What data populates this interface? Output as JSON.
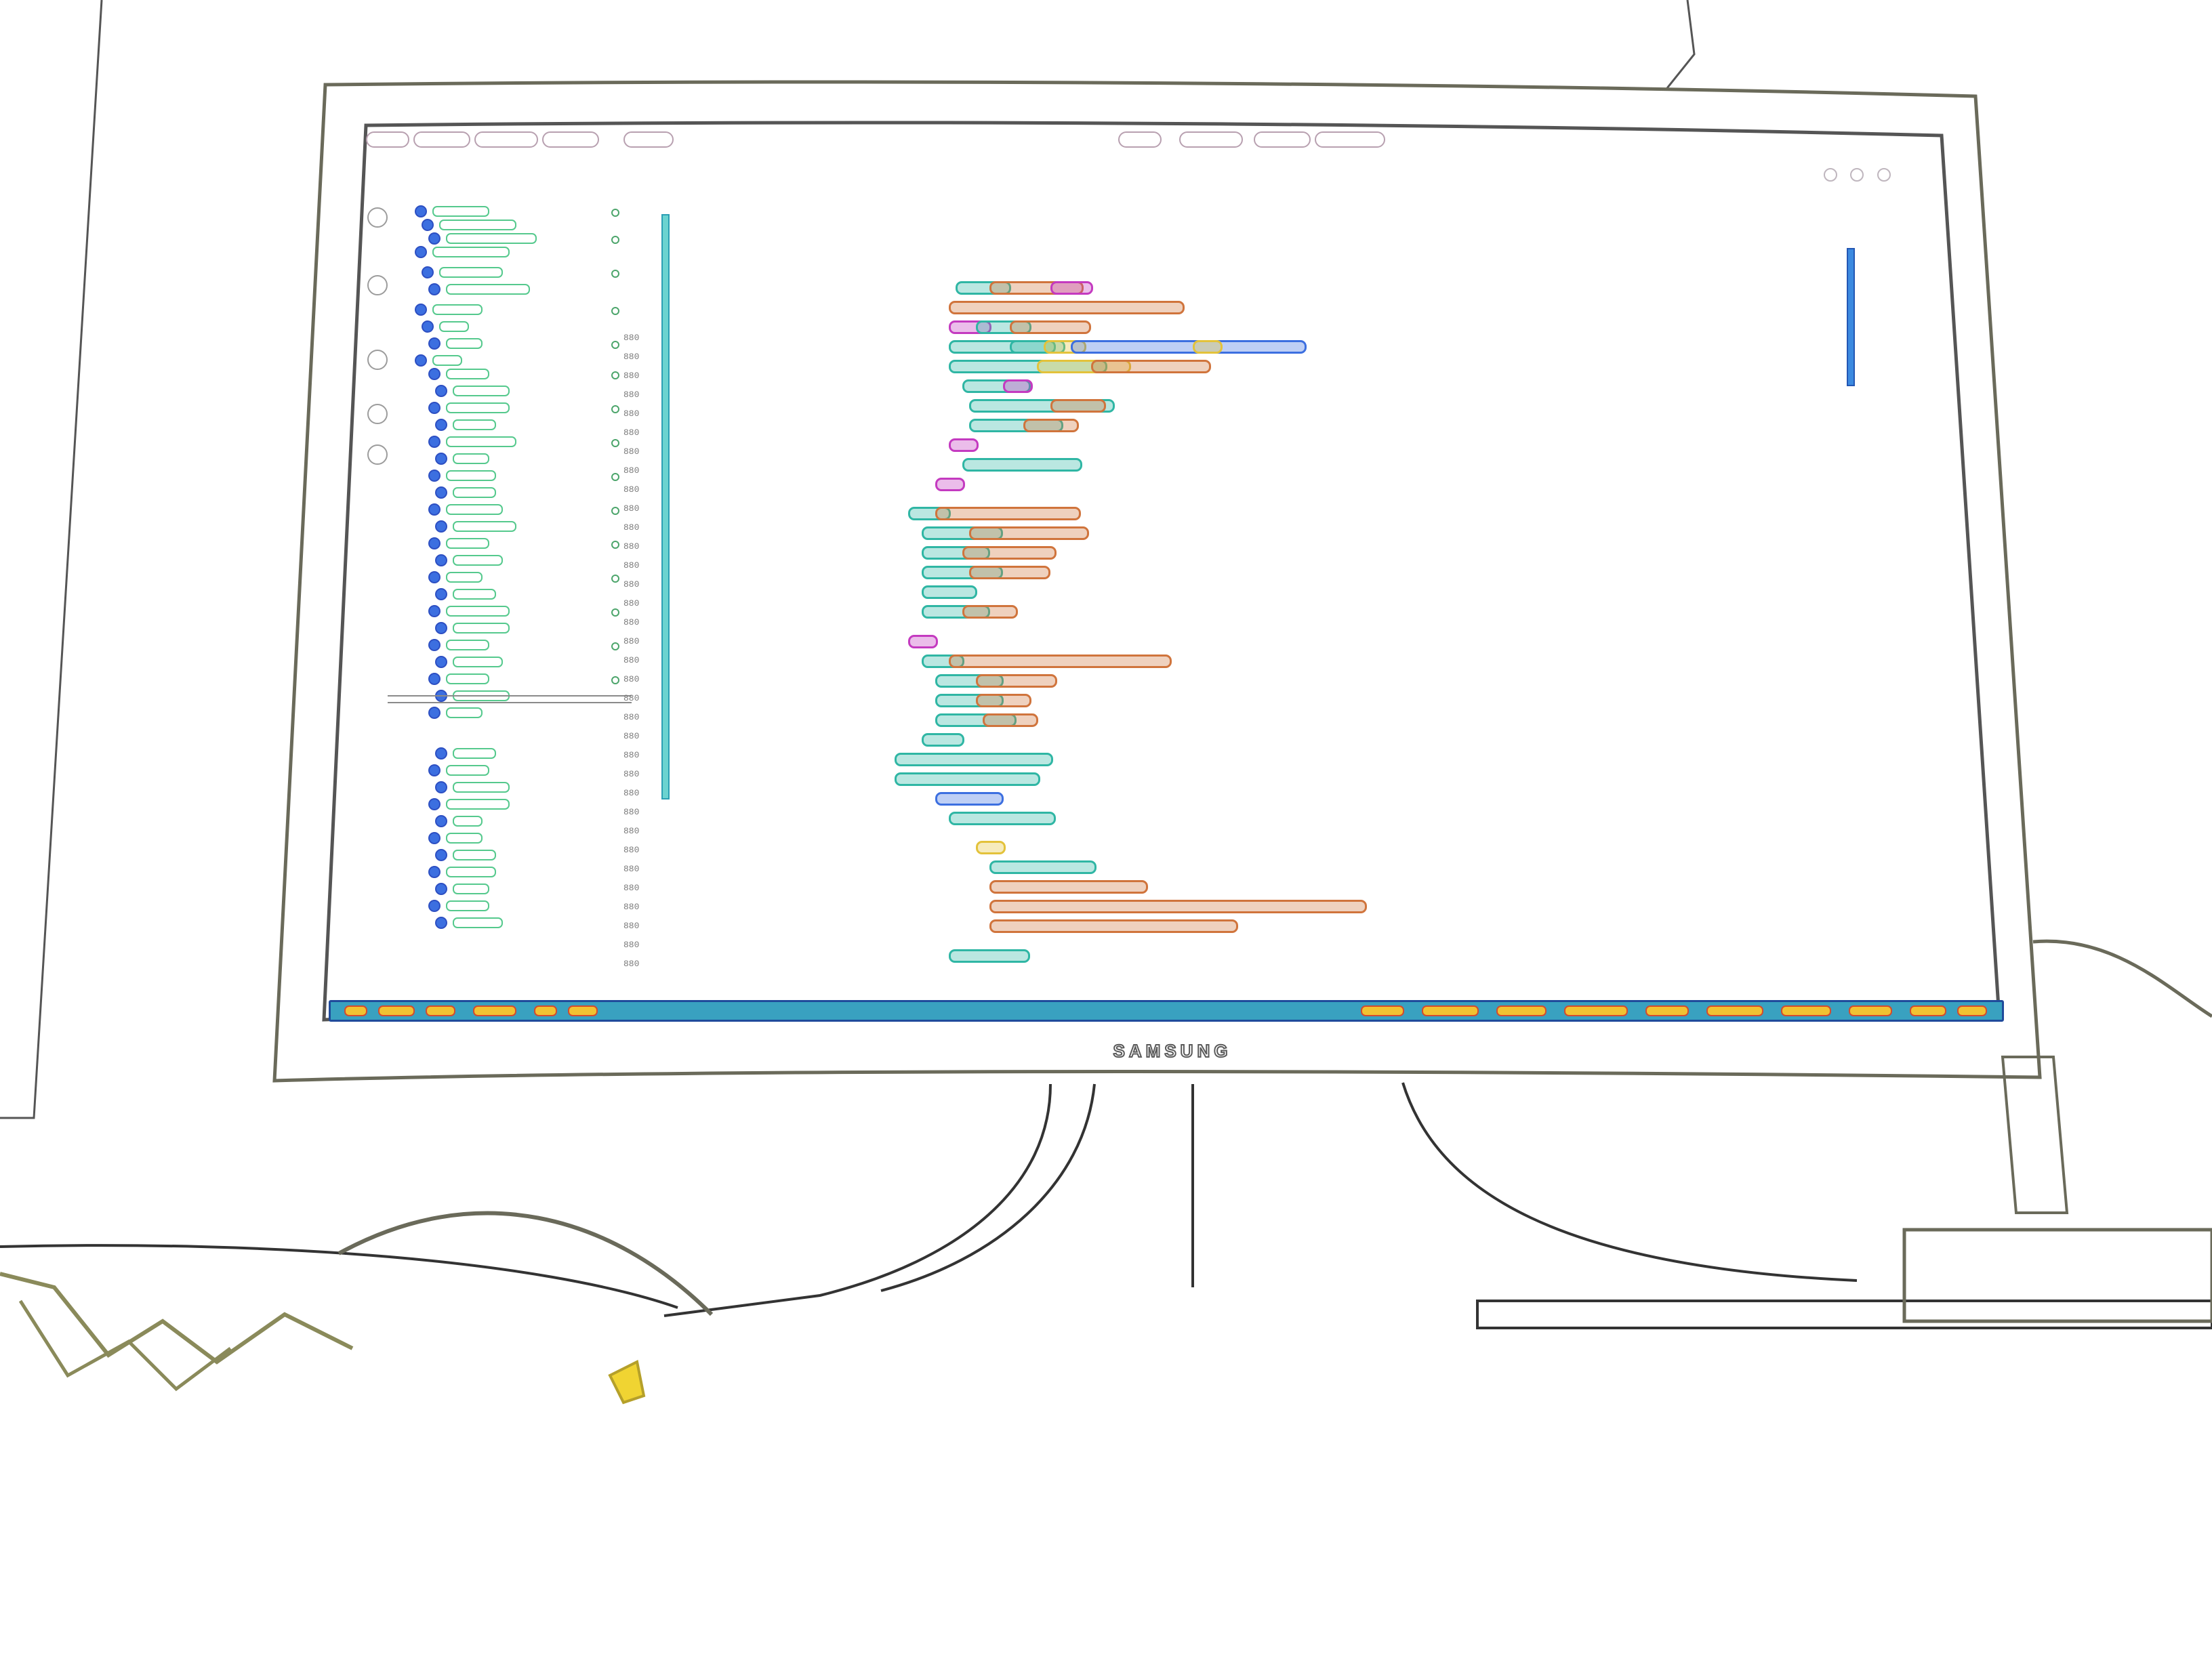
{
  "brand": "SAMSUNG",
  "editor": {
    "line_numbers": [
      "880",
      "880",
      "880",
      "880",
      "880",
      "880",
      "880",
      "880",
      "880",
      "880",
      "880",
      "880",
      "880",
      "880",
      "880",
      "880",
      "880",
      "880",
      "880",
      "880",
      "880",
      "880",
      "880",
      "880",
      "880",
      "880",
      "880",
      "880",
      "880",
      "880",
      "880",
      "880",
      "880",
      "880"
    ]
  },
  "colors": {
    "accent_blue": "#3c6fe0",
    "string_orange": "#d0743c",
    "keyword_teal": "#2fb6a4",
    "function_yellow": "#e3c23a",
    "punct_magenta": "#c43ac0",
    "statusbar": "#39a1c0"
  }
}
